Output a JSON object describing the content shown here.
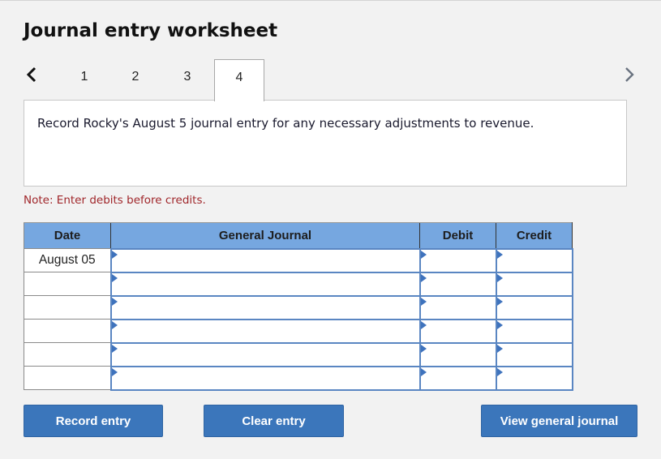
{
  "header": {
    "title": "Journal entry worksheet"
  },
  "navigation": {
    "prev_icon": "chevron-left-icon",
    "next_icon": "chevron-right-icon",
    "tabs": [
      {
        "label": "1",
        "active": false
      },
      {
        "label": "2",
        "active": false
      },
      {
        "label": "3",
        "active": false
      },
      {
        "label": "4",
        "active": true
      }
    ]
  },
  "question": {
    "text": "Record Rocky's August 5 journal entry for any necessary adjustments to revenue."
  },
  "note": "Note: Enter debits before credits.",
  "journal": {
    "columns": [
      "Date",
      "General Journal",
      "Debit",
      "Credit"
    ],
    "rows": [
      {
        "date": "August 05",
        "account": "",
        "debit": "",
        "credit": ""
      },
      {
        "date": "",
        "account": "",
        "debit": "",
        "credit": ""
      },
      {
        "date": "",
        "account": "",
        "debit": "",
        "credit": ""
      },
      {
        "date": "",
        "account": "",
        "debit": "",
        "credit": ""
      },
      {
        "date": "",
        "account": "",
        "debit": "",
        "credit": ""
      },
      {
        "date": "",
        "account": "",
        "debit": "",
        "credit": ""
      }
    ]
  },
  "buttons": {
    "record": "Record entry",
    "clear": "Clear entry",
    "view": "View general journal"
  },
  "colors": {
    "header_bg": "#76a7e0",
    "button_bg": "#3b76bb",
    "note_text": "#a0262a"
  }
}
